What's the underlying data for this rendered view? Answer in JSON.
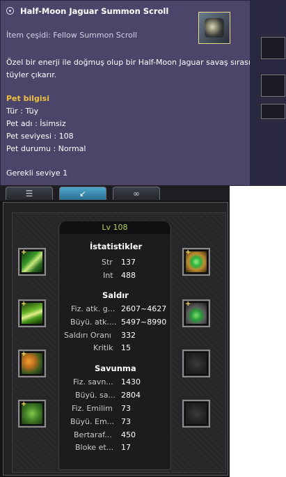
{
  "tooltip": {
    "title": "Half-Moon Jaguar Summon Scroll",
    "item_type": "İtem çeşidi: Fellow Summon Scroll",
    "description": "Özel bir enerji ile doğmuş olup bir Half-Moon Jaguar savaş sırasında çeşitli tüyler çıkarır.",
    "pet_info_header": "Pet bilgisi",
    "pet_type": "Tür : Tüy",
    "pet_name": "Pet adı : İsimsiz",
    "pet_level": "Pet seviyesi : 108",
    "pet_status": "Pet durumu : Normal",
    "required_level": "Gerekli seviye 1"
  },
  "tabs": [
    {
      "icon": "document-icon",
      "active": false
    },
    {
      "icon": "arrow-down-left-icon",
      "active": true
    },
    {
      "icon": "swirl-icon",
      "active": false
    }
  ],
  "stats": {
    "level": "Lv 108",
    "section_stats": "İstatistikler",
    "str_label": "Str",
    "str_value": "137",
    "int_label": "Int",
    "int_value": "488",
    "section_attack": "Saldır",
    "phys_atk_label": "Fiz. atk. g...",
    "phys_atk_value": "2607~4627",
    "mag_atk_label": "Büyü. atk....",
    "mag_atk_value": "5497~8990",
    "hit_label": "Saldırı Oranı",
    "hit_value": "332",
    "crit_label": "Kritik",
    "crit_value": "15",
    "section_defense": "Savunma",
    "phys_def_label": "Fiz. savn...",
    "phys_def_value": "1430",
    "mag_def_label": "Büyü. sa...",
    "mag_def_value": "2804",
    "phys_abs_label": "Fiz. Emilim",
    "phys_abs_value": "73",
    "mag_abs_label": "Büyü. Em...",
    "mag_abs_value": "73",
    "parry_label": "Bertaraf...",
    "parry_value": "450",
    "block_label": "Bloke et...",
    "block_value": "17"
  },
  "colors": {
    "tooltip_bg": "#4b4569",
    "pet_header": "#f0c040",
    "level_text": "#b6d650"
  }
}
